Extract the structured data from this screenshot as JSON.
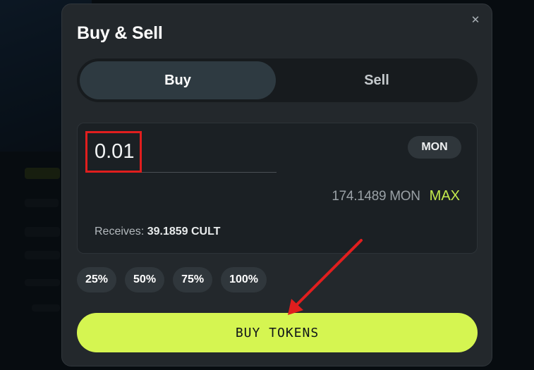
{
  "modal": {
    "title": "Buy & Sell",
    "close_icon": "close-icon"
  },
  "tabs": [
    {
      "label": "Buy",
      "active": true
    },
    {
      "label": "Sell",
      "active": false
    }
  ],
  "trade": {
    "amount_value": "0.01",
    "token": "MON",
    "balance": "174.1489 MON",
    "max_label": "MAX",
    "receives_label": "Receives:",
    "receives_value": "39.1859 CULT"
  },
  "percent_buttons": [
    "25%",
    "50%",
    "75%",
    "100%"
  ],
  "action": {
    "buy_label": "BUY TOKENS"
  },
  "colors": {
    "accent": "#d5f551",
    "max_text": "#c3ea4c",
    "annotation_red": "#e01e1e",
    "modal_bg": "#23282c"
  }
}
